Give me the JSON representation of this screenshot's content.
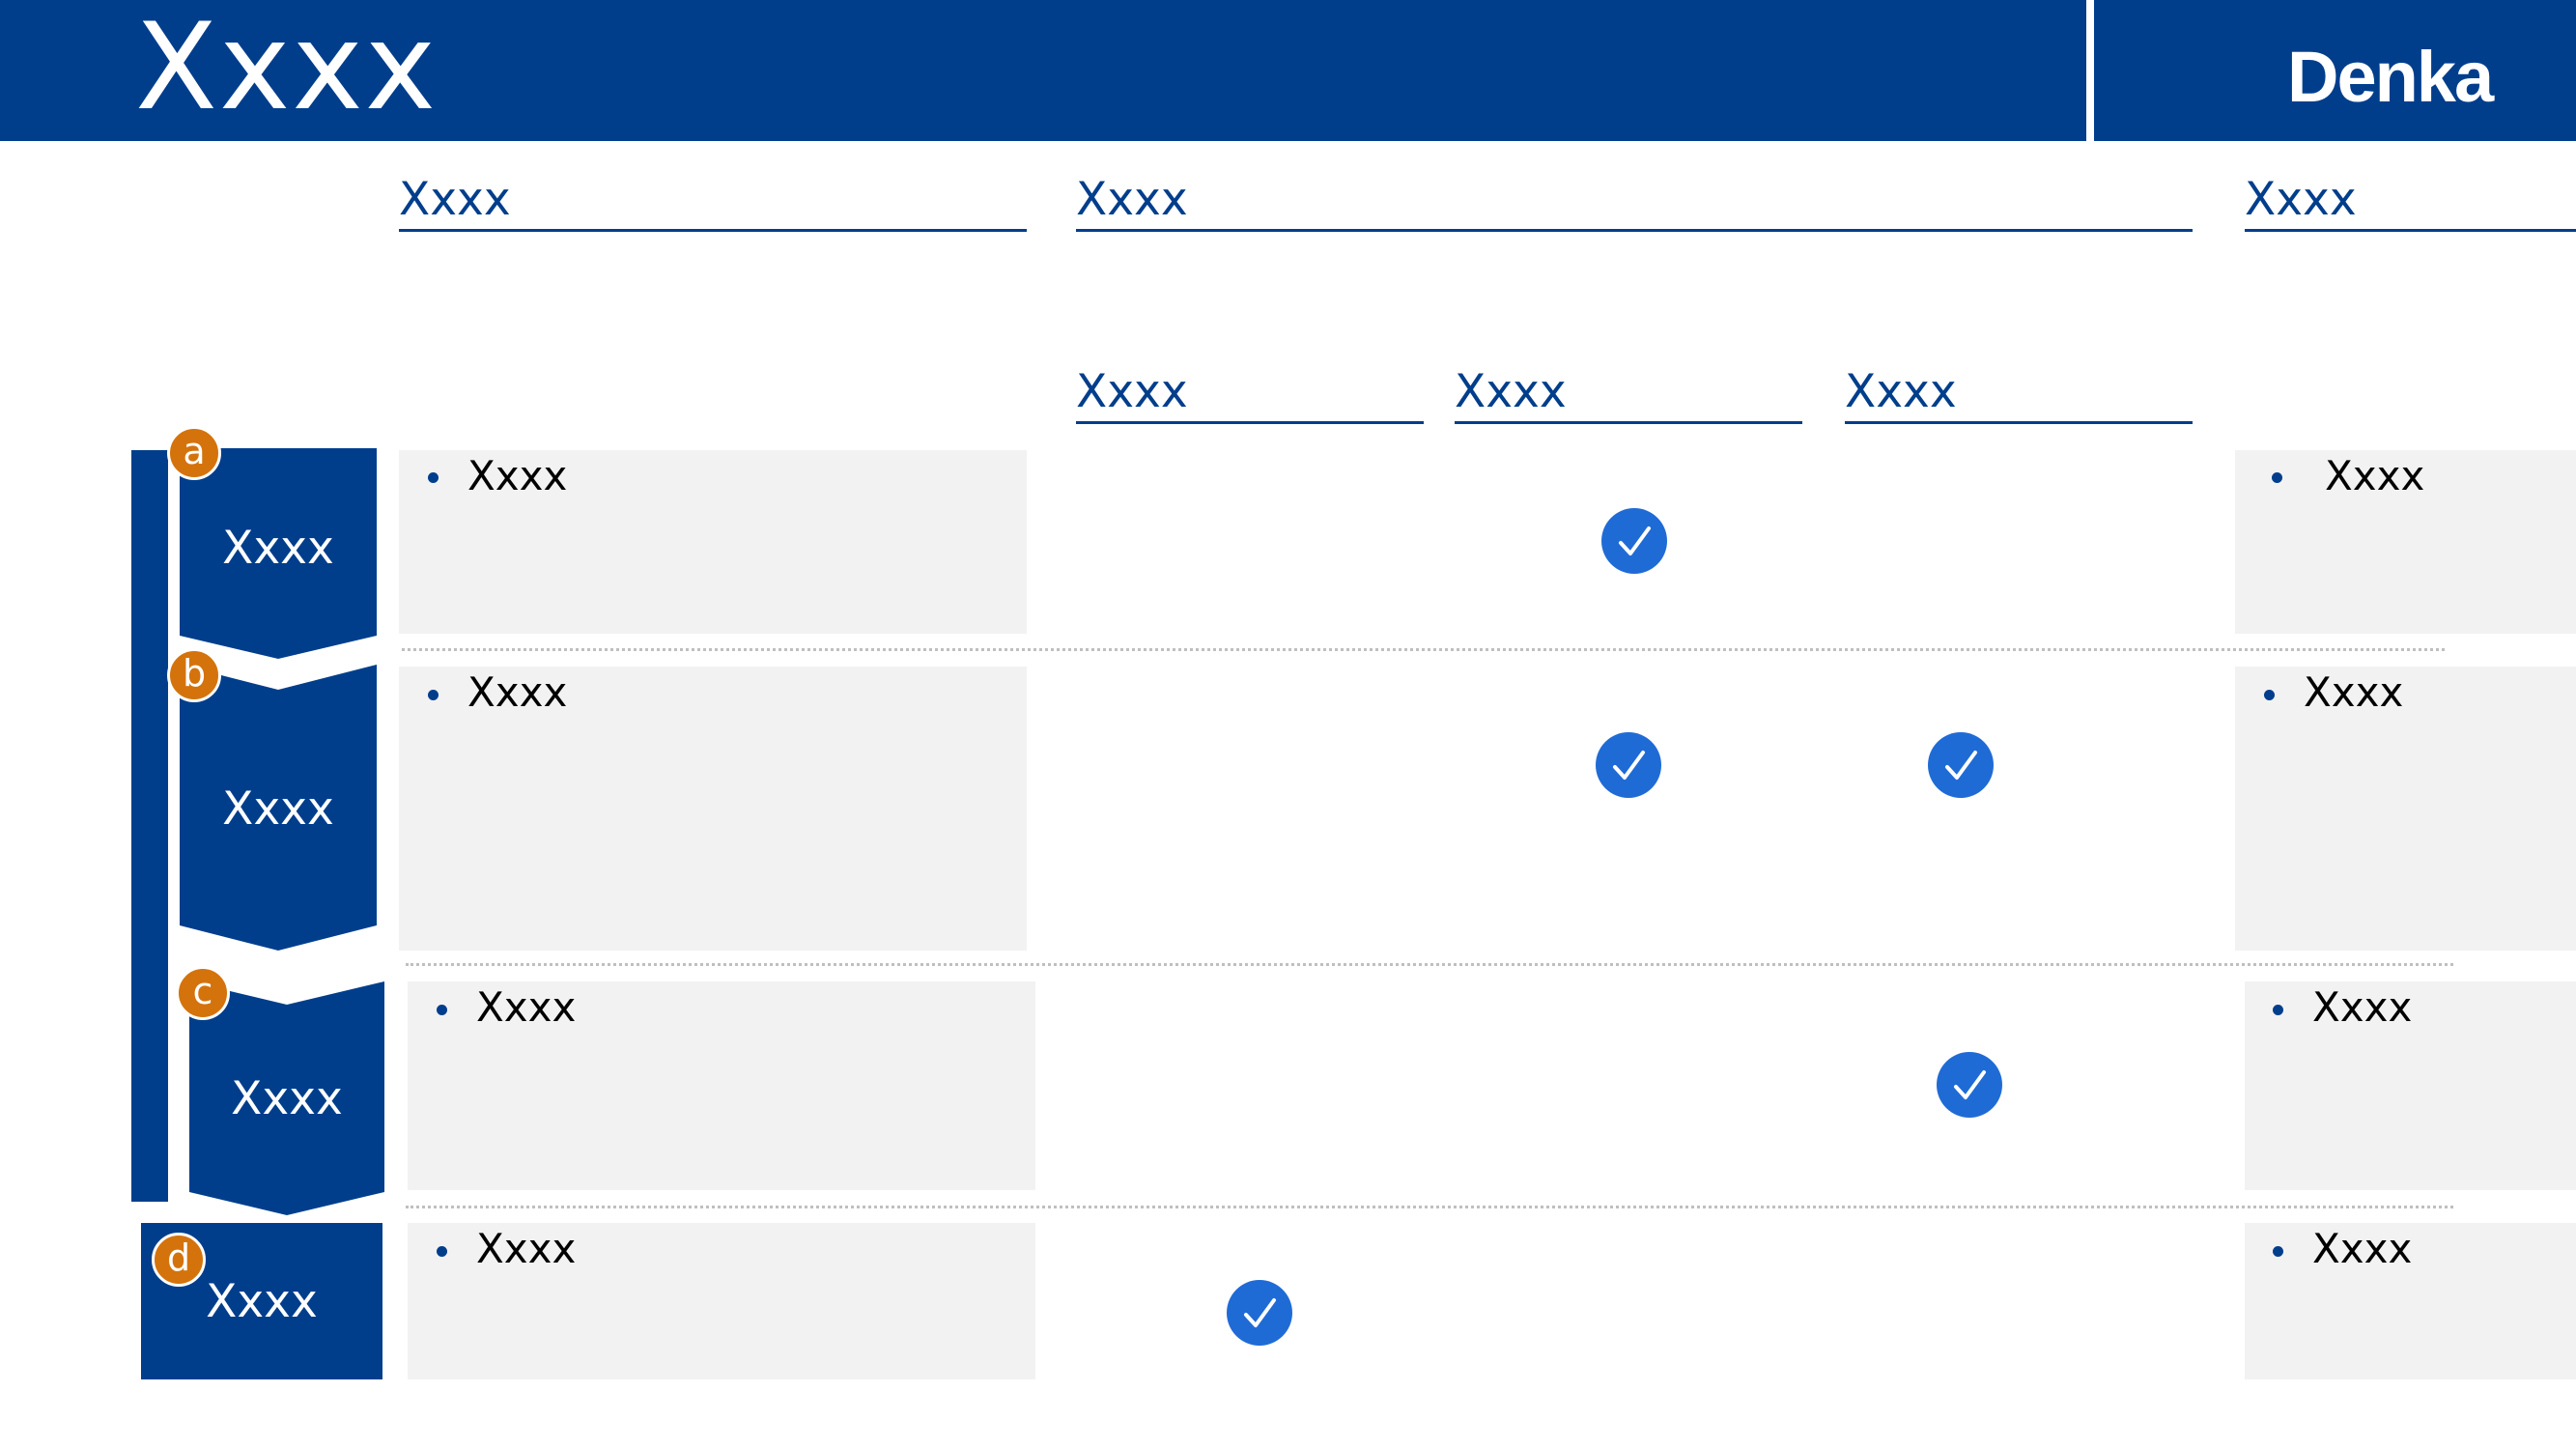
{
  "header": {
    "title": "Xxxx",
    "logo_text": "Denka"
  },
  "columns": {
    "top": [
      {
        "label": "Xxxx"
      },
      {
        "label": "Xxxx"
      },
      {
        "label": "Xxxx"
      }
    ],
    "sub": [
      {
        "label": "Xxxx"
      },
      {
        "label": "Xxxx"
      },
      {
        "label": "Xxxx"
      }
    ]
  },
  "rows": [
    {
      "marker": "a",
      "step_label": "Xxxx",
      "left_bullet": "Xxxx",
      "right_bullet": "Xxxx",
      "checks": [
        false,
        true,
        false
      ]
    },
    {
      "marker": "b",
      "step_label": "Xxxx",
      "left_bullet": "Xxxx",
      "right_bullet": "Xxxx",
      "checks": [
        false,
        true,
        true
      ]
    },
    {
      "marker": "c",
      "step_label": "Xxxx",
      "left_bullet": "Xxxx",
      "right_bullet": "Xxxx",
      "checks": [
        false,
        false,
        true
      ]
    },
    {
      "marker": "d",
      "step_label": "Xxxx",
      "left_bullet": "Xxxx",
      "right_bullet": "Xxxx",
      "checks": [
        true,
        false,
        false
      ]
    }
  ],
  "colors": {
    "brand_blue": "#003e8c",
    "marker_orange": "#d4730c",
    "check_blue": "#1f6bd6",
    "box_grey": "#f2f2f2"
  },
  "icons": {
    "check": "check-circle-icon"
  }
}
